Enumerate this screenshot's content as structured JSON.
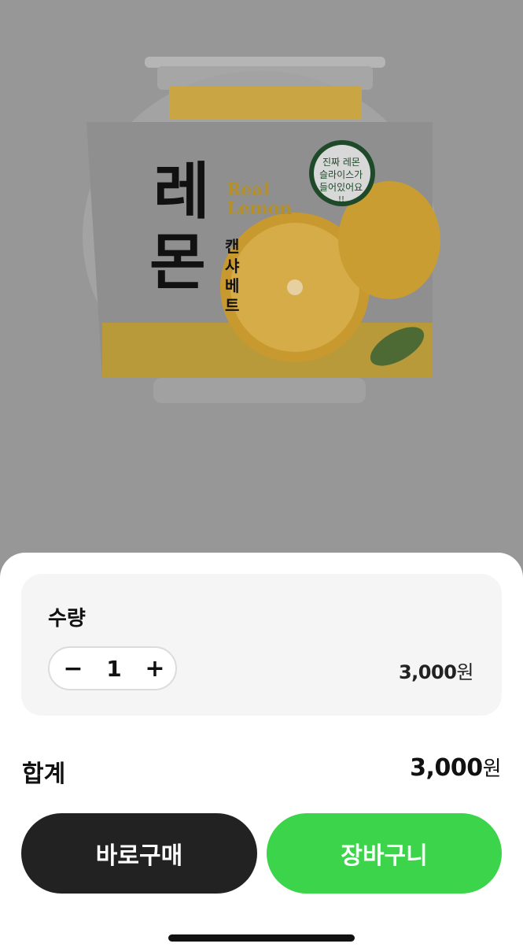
{
  "product": {
    "image_name": "lemon-canned-sherbet-jar",
    "can_label_title": "레몬",
    "can_label_sub": "캔샤베트",
    "can_label_english_1": "Real",
    "can_label_english_2": "Lemon",
    "badge_line1": "진짜 레몬",
    "badge_line2": "슬라이스가",
    "badge_line3": "들어있어요",
    "badge_line4": "!!"
  },
  "quantity_section": {
    "title": "수량",
    "minus_icon": "minus-icon",
    "plus_icon": "plus-icon",
    "minus_symbol": "−",
    "plus_symbol": "+",
    "value": "1",
    "unit_price": "3,000",
    "currency": "원"
  },
  "total": {
    "label": "합계",
    "amount": "3,000",
    "currency": "원"
  },
  "buttons": {
    "buy_now": "바로구매",
    "add_to_cart": "장바구니"
  },
  "colors": {
    "overlay": "#979797",
    "buy_now": "#222222",
    "cart": "#3bd44a",
    "card_bg": "#f5f5f5"
  }
}
